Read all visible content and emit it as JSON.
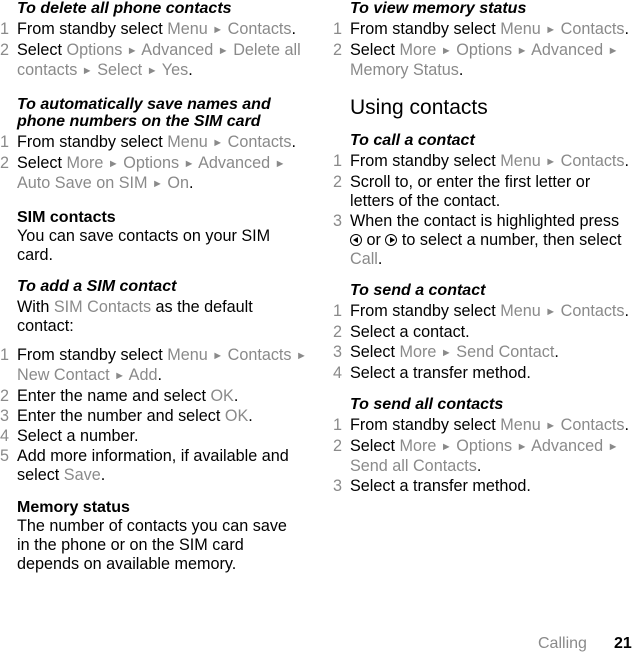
{
  "left_column": {
    "delete_all": {
      "title": "To delete all phone contacts",
      "step1": {
        "num": "1",
        "text": "From standby select ",
        "menu": "Menu",
        "contacts": "Contacts"
      },
      "step2": {
        "num": "2",
        "text": "Select ",
        "options": "Options",
        "advanced": "Advanced",
        "delete": "Delete all contacts",
        "select": "Select",
        "yes": "Yes"
      }
    },
    "auto_save": {
      "title": "To automatically save names and phone numbers on the SIM card",
      "step1": {
        "num": "1",
        "text": "From standby select ",
        "menu": "Menu",
        "contacts": "Contacts"
      },
      "step2": {
        "num": "2",
        "text": "Select ",
        "more": "More",
        "options": "Options",
        "advanced": "Advanced",
        "auto": "Auto Save on SIM",
        "on": "On"
      }
    },
    "sim_contacts": {
      "heading": "SIM contacts",
      "body": "You can save contacts on your SIM card."
    },
    "add_sim": {
      "title": "To add a SIM contact",
      "intro_pre": "With ",
      "intro_hl": "SIM Contacts",
      "intro_post": " as the default contact:",
      "step1": {
        "num": "1",
        "text": "From standby select ",
        "menu": "Menu",
        "contacts": "Contacts",
        "new": "New Contact",
        "add": "Add"
      },
      "step2": {
        "num": "2",
        "text": "Enter the name and select ",
        "ok": "OK"
      },
      "step3": {
        "num": "3",
        "text": "Enter the number and select ",
        "ok": "OK"
      },
      "step4": {
        "num": "4",
        "text": "Select a number."
      },
      "step5": {
        "num": "5",
        "text": "Add more information, if available and select ",
        "save": "Save"
      }
    },
    "memory": {
      "heading": "Memory status",
      "body": "The number of contacts you can save in the phone or on the SIM card depends on available memory."
    }
  },
  "right_column": {
    "view_memory": {
      "title": "To view memory status",
      "step1": {
        "num": "1",
        "text": "From standby select ",
        "menu": "Menu",
        "contacts": "Contacts"
      },
      "step2": {
        "num": "2",
        "text": "Select ",
        "more": "More",
        "options": "Options",
        "advanced": "Advanced",
        "status": "Memory Status"
      }
    },
    "section_title": "Using contacts",
    "call": {
      "title": "To call a contact",
      "step1": {
        "num": "1",
        "text": "From standby select ",
        "menu": "Menu",
        "contacts": "Contacts"
      },
      "step2": {
        "num": "2",
        "text": "Scroll to, or enter the first letter or letters of the contact."
      },
      "step3": {
        "num": "3",
        "text_a": "When the contact is highlighted press ",
        "text_or": " or ",
        "text_b": " to select a number, then select ",
        "call": "Call"
      }
    },
    "send_one": {
      "title": "To send a contact",
      "step1": {
        "num": "1",
        "text": "From standby select ",
        "menu": "Menu",
        "contacts": "Contacts"
      },
      "step2": {
        "num": "2",
        "text": "Select a contact."
      },
      "step3": {
        "num": "3",
        "text": "Select ",
        "more": "More",
        "send": "Send Contact"
      },
      "step4": {
        "num": "4",
        "text": "Select a transfer method."
      }
    },
    "send_all": {
      "title": "To send all contacts",
      "step1": {
        "num": "1",
        "text": "From standby select ",
        "menu": "Menu",
        "contacts": "Contacts"
      },
      "step2": {
        "num": "2",
        "text": "Select ",
        "more": "More",
        "options": "Options",
        "advanced": "Advanced",
        "send": "Send all Contacts"
      },
      "step3": {
        "num": "3",
        "text": "Select a transfer method."
      }
    }
  },
  "arrow": "►",
  "period": ".",
  "footer": {
    "section": "Calling",
    "page": "21"
  }
}
